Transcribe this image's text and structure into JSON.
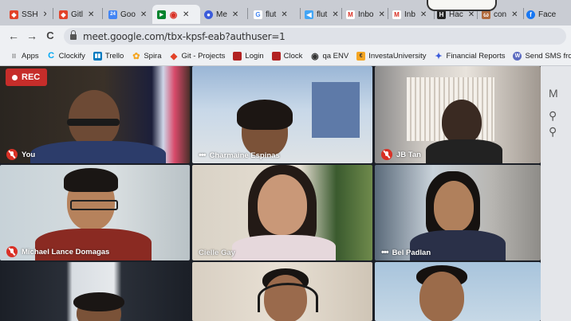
{
  "browser": {
    "tabs": [
      {
        "label": "SSH",
        "color": "#e24329",
        "glyph": "◆",
        "active": false
      },
      {
        "label": "Gitl",
        "color": "#e24329",
        "glyph": "◆",
        "active": false
      },
      {
        "label": "Goo",
        "color": "#4285f4",
        "glyph": "24",
        "active": false
      },
      {
        "label": "",
        "color": "#00832d",
        "glyph": "▶",
        "active": true
      },
      {
        "label": "Me",
        "color": "#3b5bdb",
        "glyph": "●",
        "active": false
      },
      {
        "label": "flut",
        "color": "#4285f4",
        "glyph": "G",
        "active": false
      },
      {
        "label": "flut",
        "color": "#42a5f5",
        "glyph": "◀",
        "active": false
      },
      {
        "label": "Inbo",
        "color": "#d93025",
        "glyph": "M",
        "active": false
      },
      {
        "label": "Inb",
        "color": "#d93025",
        "glyph": "M",
        "active": false
      },
      {
        "label": "Hac",
        "color": "#222222",
        "glyph": "H",
        "active": false
      },
      {
        "label": "con",
        "color": "#b06a3c",
        "glyph": "ω",
        "active": false
      },
      {
        "label": "Face",
        "color": "#1877f2",
        "glyph": "f",
        "active": false
      }
    ],
    "nav": {
      "back": "←",
      "forward": "→",
      "reload": "C"
    },
    "url": "meet.google.com/tbx-kpsf-eab?authuser=1"
  },
  "bookmarks": [
    {
      "label": "Apps",
      "color": "#555555",
      "glyph": "⋮⋮"
    },
    {
      "label": "Clockify",
      "color": "#03a9f4",
      "glyph": "C"
    },
    {
      "label": "Trello",
      "color": "#0079bf",
      "glyph": "T"
    },
    {
      "label": "Spira",
      "color": "#f5a623",
      "glyph": "✿"
    },
    {
      "label": "Git - Projects",
      "color": "#e24329",
      "glyph": "◆"
    },
    {
      "label": "Login",
      "color": "#b22222",
      "glyph": "▣"
    },
    {
      "label": "Clock",
      "color": "#b22222",
      "glyph": "▣"
    },
    {
      "label": "qa ENV",
      "color": "#333333",
      "glyph": "◉"
    },
    {
      "label": "InvestaUniversity",
      "color": "#f5a623",
      "glyph": "€"
    },
    {
      "label": "Financial Reports",
      "color": "#3b5bdb",
      "glyph": "✦"
    },
    {
      "label": "Send SMS from Out...",
      "color": "#5c6bc0",
      "glyph": "W"
    }
  ],
  "meet": {
    "rec_label": "REC",
    "participants": [
      {
        "name": "You",
        "muted": true
      },
      {
        "name": "Charmaine Espinas",
        "muted": false
      },
      {
        "name": "JB Tan",
        "muted": true
      },
      {
        "name": "Michael Lance Domagas",
        "muted": true
      },
      {
        "name": "Cielle Gay",
        "muted": false
      },
      {
        "name": "Bel Padlan",
        "muted": false
      },
      {
        "name": "",
        "muted": false
      },
      {
        "name": "",
        "muted": false
      },
      {
        "name": "",
        "muted": false
      }
    ],
    "side_icons": [
      "M",
      "⚲",
      "⚲"
    ]
  }
}
